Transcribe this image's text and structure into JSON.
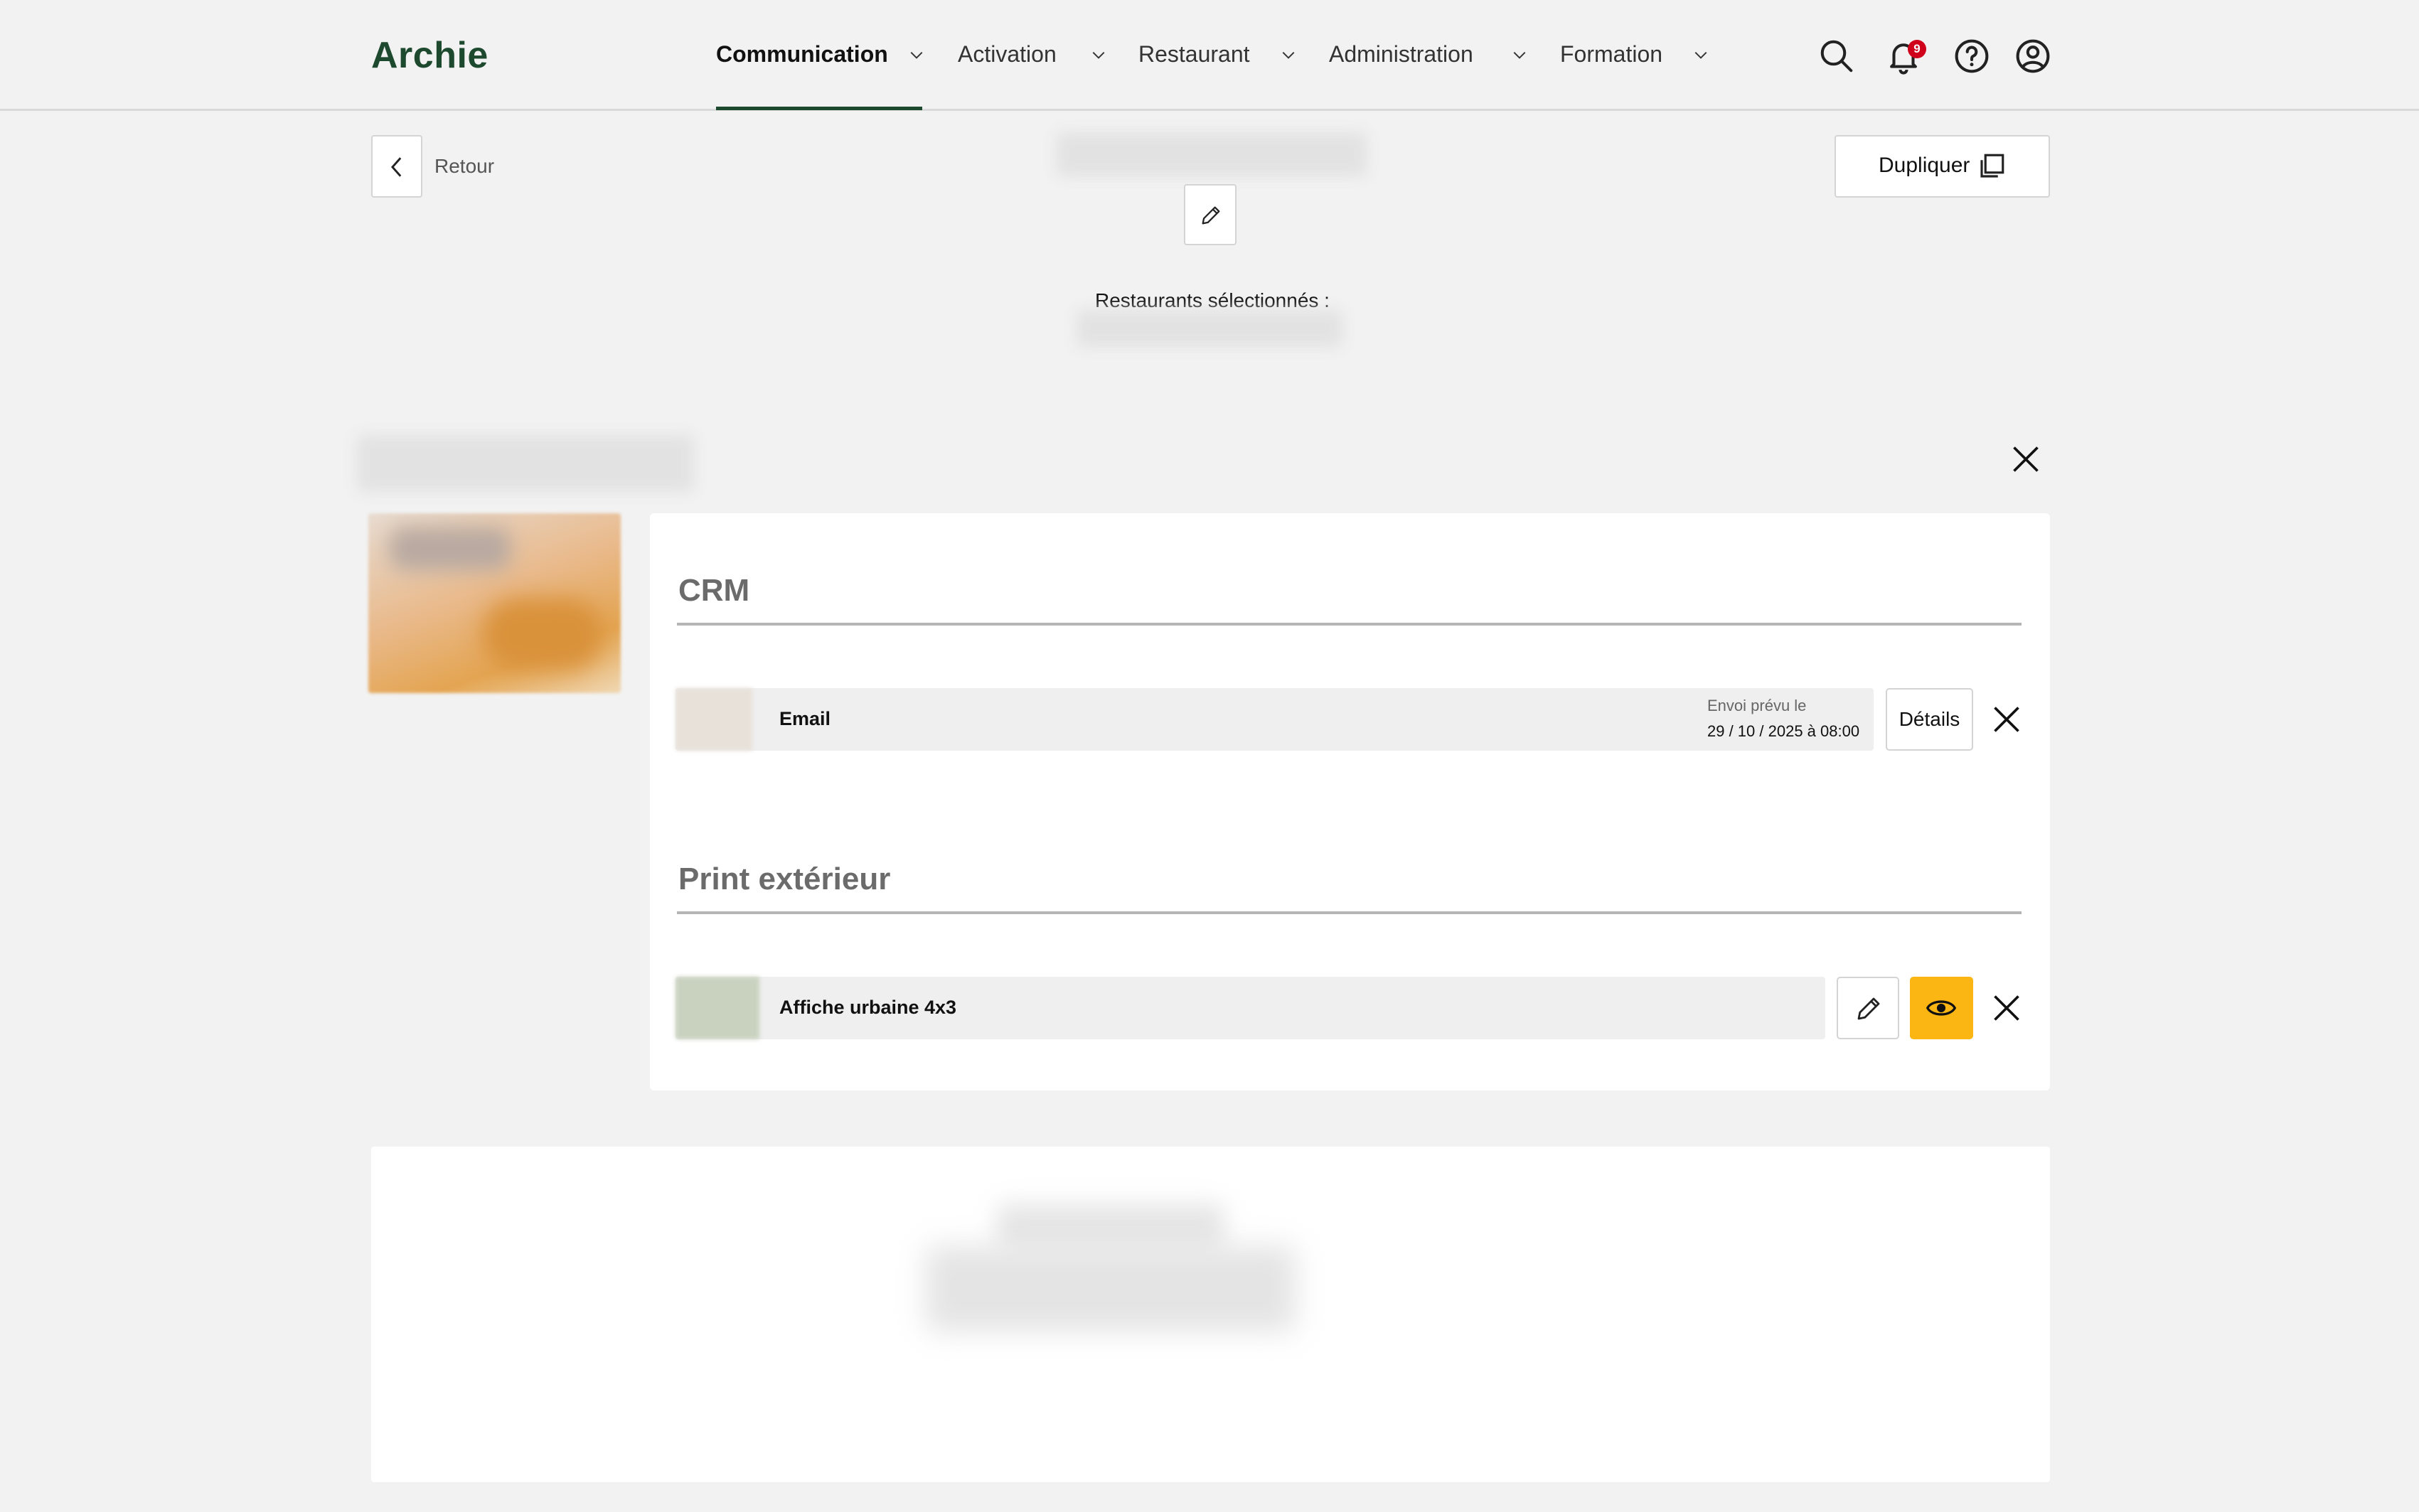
{
  "header": {
    "logo": "Archie",
    "nav": [
      {
        "label": "Communication",
        "active": true
      },
      {
        "label": "Activation",
        "active": false
      },
      {
        "label": "Restaurant",
        "active": false
      },
      {
        "label": "Administration",
        "active": false
      },
      {
        "label": "Formation",
        "active": false
      }
    ],
    "icons": [
      "search-icon",
      "bell-icon",
      "help-icon",
      "account-icon"
    ],
    "notification_count": "9"
  },
  "toolbar": {
    "back_label": "Retour",
    "duplicate_label": "Dupliquer",
    "restaurants_label": "Restaurants sélectionnés :"
  },
  "campaign": {
    "sections": [
      {
        "title": "CRM",
        "items": [
          {
            "label": "Email",
            "schedule_label": "Envoi prévu le",
            "schedule_value": "29 / 10 / 2025 à 08:00",
            "details_label": "Détails"
          }
        ]
      },
      {
        "title": "Print extérieur",
        "items": [
          {
            "label": "Affiche urbaine 4x3"
          }
        ]
      }
    ]
  },
  "colors": {
    "brand": "#1d4a2e",
    "accent": "#fbb614",
    "badge": "#d0021b"
  }
}
